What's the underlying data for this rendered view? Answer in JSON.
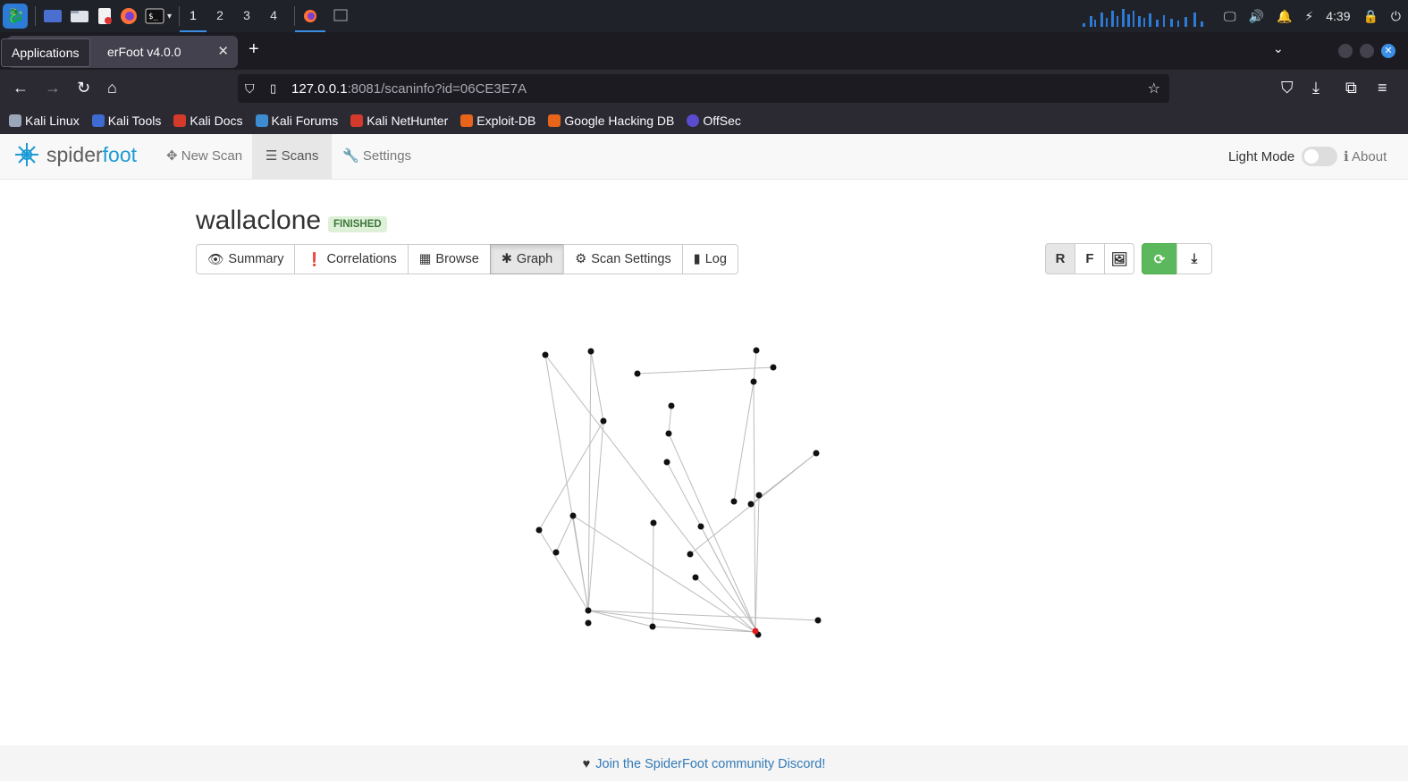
{
  "taskbar": {
    "workspaces": [
      "1",
      "2",
      "3",
      "4"
    ],
    "active_workspace": "1",
    "clock": "4:39",
    "accent": "#3a8ee6"
  },
  "browser": {
    "tooltip": "Applications",
    "tab_title": "SpiderFoot v4.0.0",
    "tab_visible_title": "erFoot v4.0.0",
    "url_host": "127.0.0.1",
    "url_rest": ":8081/scaninfo?id=06CE3E7A",
    "bookmarks": [
      {
        "label": "Kali Linux",
        "color": "#9aa7b8"
      },
      {
        "label": "Kali Tools",
        "color": "#3d6bd1"
      },
      {
        "label": "Kali Docs",
        "color": "#d33a2c"
      },
      {
        "label": "Kali Forums",
        "color": "#3d8bd1"
      },
      {
        "label": "Kali NetHunter",
        "color": "#d33a2c"
      },
      {
        "label": "Exploit-DB",
        "color": "#e8641b"
      },
      {
        "label": "Google Hacking DB",
        "color": "#e8641b"
      },
      {
        "label": "OffSec",
        "color": "#5b4bd1"
      }
    ]
  },
  "app": {
    "brand_spider": "spider",
    "brand_foot": "foot",
    "nav": {
      "new_scan": "New Scan",
      "scans": "Scans",
      "settings": "Settings",
      "light_mode": "Light Mode",
      "about": "About"
    },
    "brand_color": "#1c9ad6"
  },
  "scan": {
    "name": "wallaclone",
    "status": "FINISHED",
    "tabs": {
      "summary": "Summary",
      "correlations": "Correlations",
      "browse": "Browse",
      "graph": "Graph",
      "scan_settings": "Scan Settings",
      "log": "Log"
    },
    "active_tab": "Graph",
    "graph_tools": {
      "r": "R",
      "f": "F"
    }
  },
  "footer": {
    "link": "Join the SpiderFoot community Discord!"
  }
}
